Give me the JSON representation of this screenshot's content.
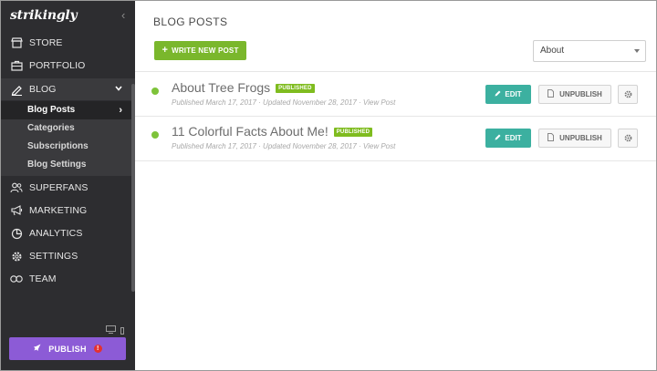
{
  "sidebar": {
    "logo": "strikingly",
    "collapse_icon": "chevron-left-icon",
    "nav": [
      {
        "label": "STORE",
        "icon": "store-icon"
      },
      {
        "label": "PORTFOLIO",
        "icon": "briefcase-icon"
      },
      {
        "label": "BLOG",
        "icon": "pen-icon"
      },
      {
        "label": "SUPERFANS",
        "icon": "users-icon"
      },
      {
        "label": "MARKETING",
        "icon": "megaphone-icon"
      },
      {
        "label": "ANALYTICS",
        "icon": "pie-chart-icon"
      },
      {
        "label": "SETTINGS",
        "icon": "gear-icon"
      },
      {
        "label": "TEAM",
        "icon": "team-icon"
      }
    ],
    "blog_submenu": [
      "Blog Posts",
      "Categories",
      "Subscriptions",
      "Blog Settings"
    ],
    "publish_label": "PUBLISH",
    "publish_alert": "!"
  },
  "main": {
    "title": "BLOG POSTS",
    "write_button": "WRITE NEW POST",
    "filter_selected": "About",
    "posts": [
      {
        "title": "About Tree Frogs",
        "status": "PUBLISHED",
        "meta": "Published March 17, 2017 · Updated November 28, 2017 · View Post",
        "edit": "EDIT",
        "unpublish": "UNPUBLISH"
      },
      {
        "title": "11 Colorful Facts About Me!",
        "status": "PUBLISHED",
        "meta": "Published March 17, 2017 · Updated November 28, 2017 · View Post",
        "edit": "EDIT",
        "unpublish": "UNPUBLISH"
      }
    ]
  },
  "colors": {
    "sidebar_bg": "#2d2d30",
    "publish": "#8c5bd6",
    "write_button": "#7ab72c",
    "edit_button": "#3cb0a0",
    "published_badge": "#7fbc1f",
    "status_dot": "#7ec33a"
  }
}
